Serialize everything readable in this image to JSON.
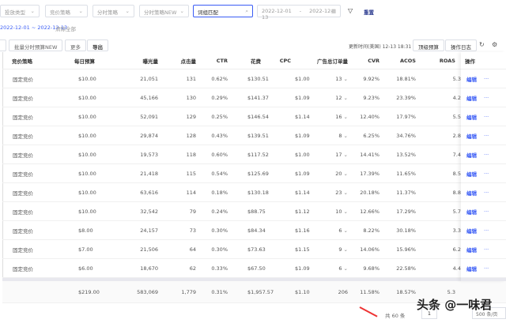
{
  "filters": {
    "type": "投放类型",
    "bid_strategy": "竞价策略",
    "time_strategy": "分时策略",
    "time_strategy_new": "分时策略NEW",
    "search_value": "词组匹配",
    "date_start": "2022-12-01",
    "date_sep": "-",
    "date_end": "2022-12-13",
    "reset": "重置"
  },
  "active_filter": {
    "date_range": "2022-12-01 ~ 2022-12-13",
    "clear": "清除全部"
  },
  "toolbar": {
    "batch_time": "批量分时预算NEW",
    "more": "更多",
    "export": "导出",
    "update_time": "更新时间(美国) 12-13 18:31",
    "top_budget": "顶级预算",
    "op_log": "操作日志"
  },
  "columns": [
    "竞价策略",
    "每日预算",
    "曝光量",
    "点击量",
    "CTR",
    "花费",
    "CPC",
    "广告总订单量",
    "CVR",
    "ACOS",
    "ROAS",
    "操作"
  ],
  "rows": [
    [
      "固定竞价",
      "$10.00",
      "21,051",
      "131",
      "0.62%",
      "$130.51",
      "$1.00",
      "13",
      "9.92%",
      "18.81%",
      "5.3"
    ],
    [
      "固定竞价",
      "$10.00",
      "45,166",
      "130",
      "0.29%",
      "$141.37",
      "$1.09",
      "12",
      "9.23%",
      "23.39%",
      "4.2"
    ],
    [
      "固定竞价",
      "$10.00",
      "52,091",
      "129",
      "0.25%",
      "$146.54",
      "$1.14",
      "16",
      "12.40%",
      "17.97%",
      "5.5"
    ],
    [
      "固定竞价",
      "$10.00",
      "29,874",
      "128",
      "0.43%",
      "$139.51",
      "$1.09",
      "8",
      "6.25%",
      "34.76%",
      "2.8"
    ],
    [
      "固定竞价",
      "$10.00",
      "19,573",
      "118",
      "0.60%",
      "$117.52",
      "$1.00",
      "17",
      "14.41%",
      "13.52%",
      "7.4"
    ],
    [
      "固定竞价",
      "$10.00",
      "21,418",
      "115",
      "0.54%",
      "$125.69",
      "$1.09",
      "20",
      "17.39%",
      "11.65%",
      "8.5"
    ],
    [
      "固定竞价",
      "$10.00",
      "63,616",
      "114",
      "0.18%",
      "$130.18",
      "$1.14",
      "23",
      "20.18%",
      "11.37%",
      "8.8"
    ],
    [
      "固定竞价",
      "$10.00",
      "32,542",
      "79",
      "0.24%",
      "$88.75",
      "$1.12",
      "10",
      "12.66%",
      "17.29%",
      "5.7"
    ],
    [
      "固定竞价",
      "$8.00",
      "24,157",
      "73",
      "0.30%",
      "$84.34",
      "$1.16",
      "6",
      "8.22%",
      "30.18%",
      "3.3"
    ],
    [
      "固定竞价",
      "$7.00",
      "21,506",
      "64",
      "0.30%",
      "$73.63",
      "$1.15",
      "9",
      "14.06%",
      "15.96%",
      "6.2"
    ],
    [
      "固定竞价",
      "$6.00",
      "18,670",
      "62",
      "0.33%",
      "$67.50",
      "$1.09",
      "6",
      "9.68%",
      "22.58%",
      "4.4"
    ]
  ],
  "row_actions": {
    "edit": "编辑",
    "more": "···"
  },
  "totals": [
    "",
    "$219.00",
    "583,069",
    "1,779",
    "0.31%",
    "$1,957.57",
    "$1.10",
    "206",
    "11.58%",
    "18.57%",
    "5.3"
  ],
  "pagination": {
    "total": "共 60 条",
    "page": "1",
    "page_size": "500 条/页"
  },
  "watermark": "头条 @一味君",
  "colors": {
    "accent": "#3a5cf5",
    "border": "#dcdfe6"
  }
}
